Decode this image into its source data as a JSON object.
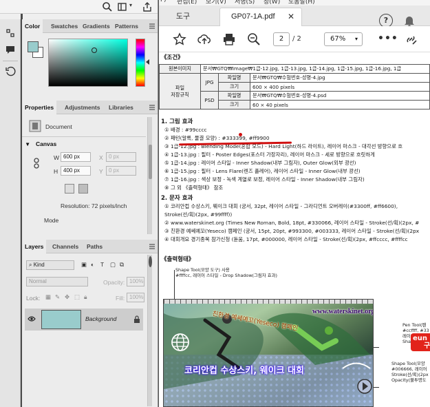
{
  "ps": {
    "color_panel": {
      "tabs": [
        "Color",
        "Swatches",
        "Gradients",
        "Patterns"
      ],
      "foreground": "#99cccc"
    },
    "properties_panel": {
      "tabs": [
        "Properties",
        "Adjustments",
        "Libraries"
      ],
      "doc_label": "Document",
      "section": "Canvas",
      "w_label": "W",
      "w_value": "600 px",
      "h_label": "H",
      "h_value": "400 px",
      "x_label": "X",
      "x_value": "0 px",
      "y_label": "Y",
      "y_value": "0 px",
      "resolution": "Resolution: 72 pixels/inch",
      "mode_label": "Mode"
    },
    "layers_panel": {
      "tabs": [
        "Layers",
        "Channels",
        "Paths"
      ],
      "kind_label": "Kind",
      "blend_mode": "Normal",
      "opacity_label": "Opacity:",
      "opacity_value": "100%",
      "lock_label": "Lock:",
      "fill_label": "Fill:",
      "fill_value": "100%",
      "layer_name": "Background"
    }
  },
  "pdf": {
    "menu": [
      "F)",
      "편집(E)",
      "보기(V)",
      "서명(S)",
      "창(W)",
      "도움말(H)"
    ],
    "tool_tab": "도구",
    "doc_tab": "GP07-1A.pdf",
    "page_current": "2",
    "page_total": "/  2",
    "zoom": "67%",
    "doc": {
      "cond_heading": "《조건》",
      "row1_label": "원본이미지",
      "row1_value": "문서₩GTQ₩Image₩1급-12.jpg, 1급-13.jpg, 1급-14.jpg, 1급-15.jpg, 1급-16.jpg, 1급",
      "row2_label1": "파일",
      "row2_label2": "저장규칙",
      "jpg": "JPG",
      "psd": "PSD",
      "fname_label": "파일명",
      "size_label": "크기",
      "jpg_fname": "문서₩GTQ₩수험번호-성명-4.jpg",
      "jpg_size": "600 × 400 pixels",
      "psd_fname": "문서₩GTQ₩수험번호-성명-4.psd",
      "psd_size": "60 × 40 pixels",
      "s1_title": "1. 그림 효과",
      "s1_items": [
        "① 배경 : #99cccc",
        "② 패턴(알록, 물결 모양) : #333399, #ff9900",
        "③ 1급-12.jpg : Blending Mode(혼합 모드) - Hard Light(하드 라이트), 레이어 마스크 - 대각선 방향으로 흐",
        "④ 1급-13.jpg : 필터 - Poster Edges(포스터 가장자리), 레이어 마스크 - 세로 방향으로 흐릿하게",
        "⑤ 1급-14.jpg : 레이어 스타일 - Inner Shadow(내부 그림자), Outer Glow(외부 광선)",
        "⑥ 1급-15.jpg : 필터 - Lens Flare(렌즈 플레어), 레이어 스타일 - Inner Glow(내부 광선)",
        "⑦ 1급-16.jpg : 색상 보정 - 녹색 계열로 보정, 레이어 스타일 - Inner Shadow(내부 그림자)",
        "⑧ 그 외 《출력형태》 참조"
      ],
      "s2_title": "2. 문자 효과",
      "s2_items": [
        "① 코리안컵 수상스키, 웨이크 대회 (궁서, 32pt, 레이어 스타일 - 그라디언트 오버레이(#3300ff, #ff6600),",
        "    Stroke(선/획)(2px, #99ffff))",
        "② www.waterskinet.org (Times New Roman, Bold, 18pt, #330066, 레이어 스타일 - Stroke(선/획)(2px, #",
        "③ 친환경 예쎄예꼬(Yeseco) 캠페인 (궁서, 15pt, 20pt, #993300, #003333, 레이어 스타일 - Stroke(선/획)(2px",
        "④ 대회개요 경기종목 참가신청 (돋움, 17pt, #000000, 레이어 스타일 - Stroke(선/획)(2px, #ffcccc, #ffffcc"
      ],
      "out_heading": "《출력형태》",
      "callout_top1": "Shape Tool(모양 도구) 사용",
      "callout_top2": "#ffffcc, 레이어 스타일 - Drop Shadow(그림자 효과)",
      "sample_url": "www.waterskinet.org",
      "sample_campaign": "친환경 예쎄예꼬(Yeseco) 캠페인",
      "sample_title": "코리안컵 수상스키, 웨이크 대회",
      "callout_r1": [
        "Pen Tool(펜",
        "#ccffff, #33",
        "레이어 스타",
        "Shadow(그림"
      ],
      "callout_r2": [
        "Shape Tool(모양",
        "#006666, 레이어",
        "Stroke(선/획)(2px",
        "Opacity(불투명도"
      ]
    },
    "badge": [
      "eun",
      "구"
    ]
  }
}
